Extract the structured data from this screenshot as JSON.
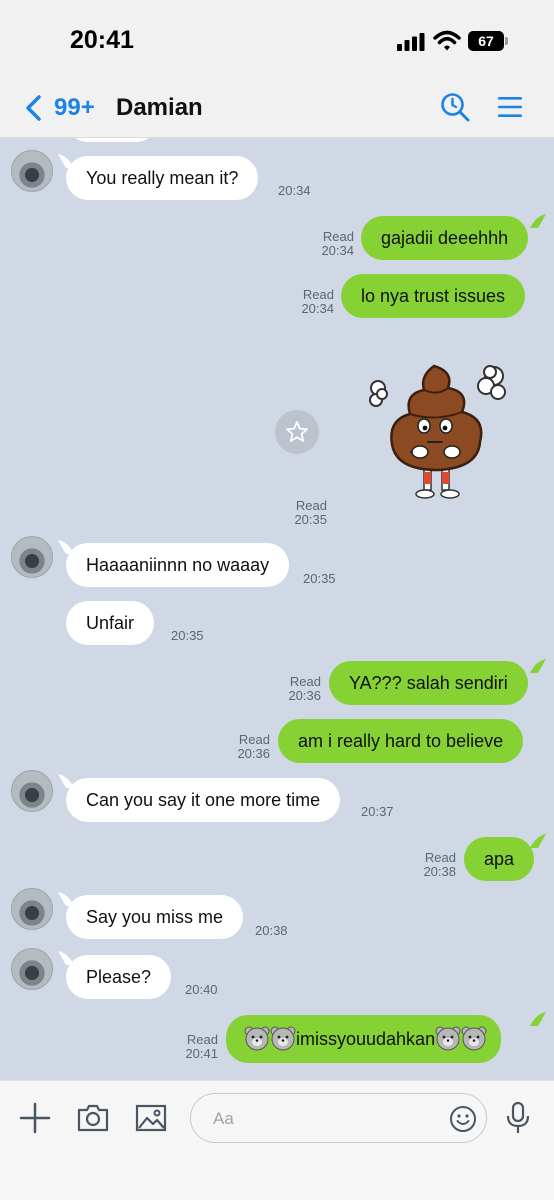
{
  "status_bar": {
    "time": "20:41",
    "battery": "67"
  },
  "header": {
    "back_count": "99+",
    "contact_name": "Damian"
  },
  "messages": [
    {
      "dir": "in",
      "text": "You really mean it?",
      "time": "20:34"
    },
    {
      "dir": "out",
      "text": "gajadii deeehhh",
      "read": "Read",
      "time": "20:34"
    },
    {
      "dir": "out",
      "text": "lo nya trust issues",
      "read": "Read",
      "time": "20:34"
    },
    {
      "dir": "out",
      "type": "sticker",
      "sticker": "poop-sticker",
      "read": "Read",
      "time": "20:35"
    },
    {
      "dir": "in",
      "text": "Haaaaniinnn no waaay",
      "time": "20:35"
    },
    {
      "dir": "in",
      "text": "Unfair",
      "time": "20:35"
    },
    {
      "dir": "out",
      "text": "YA??? salah sendiri",
      "read": "Read",
      "time": "20:36"
    },
    {
      "dir": "out",
      "text": "am i really hard to believe",
      "read": "Read",
      "time": "20:36"
    },
    {
      "dir": "in",
      "text": "Can you say it one more time",
      "time": "20:37"
    },
    {
      "dir": "out",
      "text": "apa",
      "read": "Read",
      "time": "20:38"
    },
    {
      "dir": "in",
      "text": "Say you miss me",
      "time": "20:38"
    },
    {
      "dir": "in",
      "text": "Please?",
      "time": "20:40"
    },
    {
      "dir": "out",
      "text": "imissyouudahkan",
      "read": "Read",
      "time": "20:41",
      "emoji": "bear-emoji"
    }
  ],
  "input": {
    "placeholder": "Aa"
  },
  "colors": {
    "accent": "#1b82e6",
    "outgoing_bubble": "#86d234",
    "incoming_bubble": "#ffffff",
    "chat_background": "#cfd8e4"
  }
}
